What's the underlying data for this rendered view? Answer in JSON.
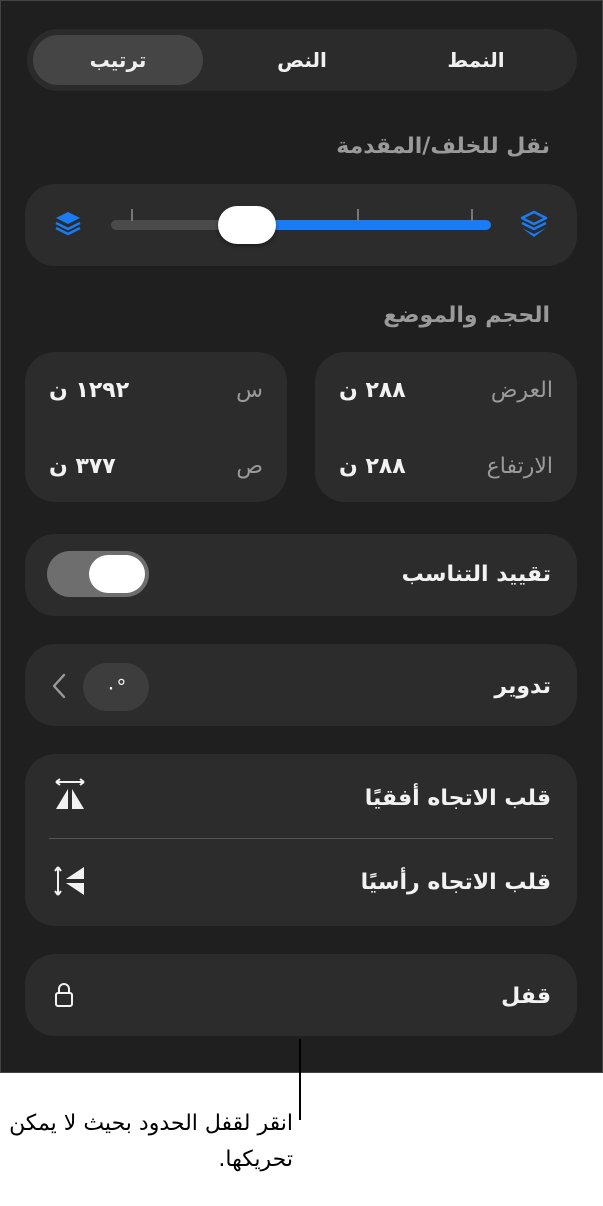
{
  "tabs": [
    {
      "label": "النمط",
      "active": false
    },
    {
      "label": "النص",
      "active": false
    },
    {
      "label": "ترتيب",
      "active": true
    }
  ],
  "arrange": {
    "section_title": "نقل للخلف/المقدمة",
    "slider_value": 0.4,
    "accent_color": "#1a7cf5"
  },
  "size_position": {
    "section_title": "الحجم والموضع",
    "width_label": "العرض",
    "width_value": "٢٨٨ ن",
    "height_label": "الارتفاع",
    "height_value": "٢٨٨ ن",
    "x_label": "س",
    "x_value": "١٢٩٢ ن",
    "y_label": "ص",
    "y_value": "٣٧٧ ن"
  },
  "constrain": {
    "label": "تقييد التناسب",
    "on": true
  },
  "rotate": {
    "label": "تدوير",
    "value": "٠°"
  },
  "flip": {
    "horizontal_label": "قلب الاتجاه أفقيًا",
    "vertical_label": "قلب الاتجاه رأسيًا"
  },
  "lock": {
    "label": "قفل"
  },
  "callout": {
    "text": "انقر لقفل الحدود بحيث لا يمكن تحريكها."
  }
}
